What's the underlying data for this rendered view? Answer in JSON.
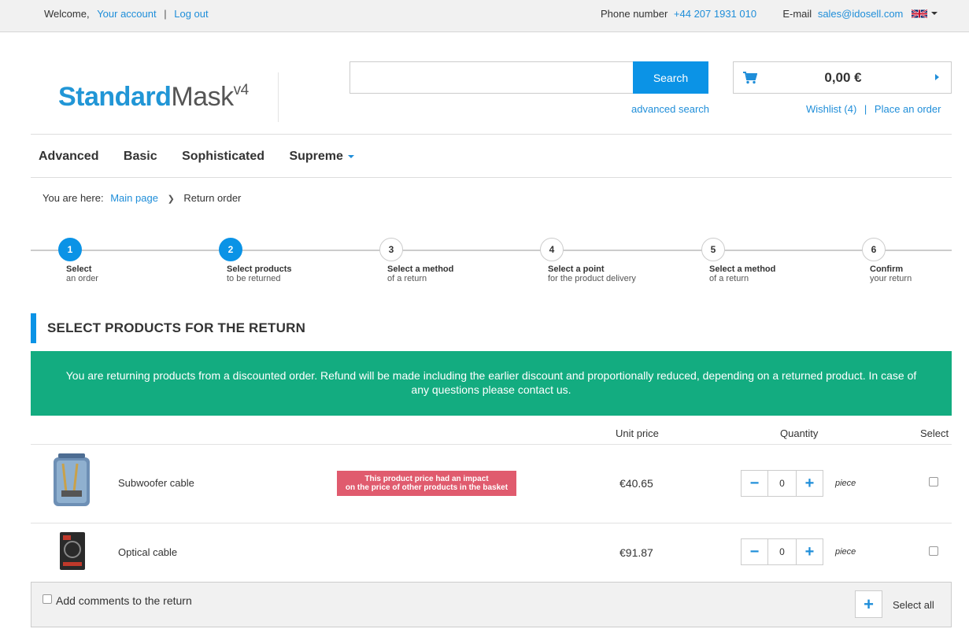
{
  "topbar": {
    "welcome": "Welcome,",
    "account_link": "Your account",
    "separator": "|",
    "logout_link": "Log out",
    "phone_label": "Phone number",
    "phone_value": "+44 207 1931 010",
    "email_label": "E-mail",
    "email_value": "sales@idosell.com",
    "language_icon": "uk-flag-icon"
  },
  "header": {
    "logo_part1": "Standard",
    "logo_part2": "Mask",
    "logo_sup": "v4",
    "search_value": "",
    "search_button": "Search",
    "advanced_search": "advanced search",
    "basket_total": "0,00 €",
    "wishlist_link": "Wishlist (4)",
    "place_order_link": "Place an order",
    "link_separator": "|"
  },
  "nav": {
    "items": [
      {
        "label": "Advanced"
      },
      {
        "label": "Basic"
      },
      {
        "label": "Sophisticated"
      },
      {
        "label": "Supreme"
      }
    ]
  },
  "breadcrumb": {
    "prefix": "You are here:",
    "home": "Main page",
    "current": "Return order"
  },
  "steps": [
    {
      "num": "1",
      "title": "Select",
      "sub": "an order",
      "active": true
    },
    {
      "num": "2",
      "title": "Select products",
      "sub": "to be returned",
      "active": true
    },
    {
      "num": "3",
      "title": "Select a method",
      "sub": "of a return",
      "active": false
    },
    {
      "num": "4",
      "title": "Select a point",
      "sub": "for the product delivery",
      "active": false
    },
    {
      "num": "5",
      "title": "Select a method",
      "sub": "of a return",
      "active": false
    },
    {
      "num": "6",
      "title": "Confirm",
      "sub": "your return",
      "active": false
    }
  ],
  "section_title": "SELECT PRODUCTS FOR THE RETURN",
  "notice": "You are returning products from a discounted order. Refund will be made including the earlier discount and proportionally reduced, depending on a returned product. In case of any questions please contact us.",
  "table": {
    "headers": {
      "unit_price": "Unit price",
      "quantity": "Quantity",
      "select": "Select"
    },
    "rows": [
      {
        "name": "Subwoofer cable",
        "price": "€40.65",
        "qty": "0",
        "unit": "piece",
        "warning_line1": "This product price had an impact",
        "warning_line2": "on the price of other products in the basket",
        "checked": false
      },
      {
        "name": "Optical cable",
        "price": "€91.87",
        "qty": "0",
        "unit": "piece",
        "checked": false
      }
    ],
    "minus": "−",
    "plus": "+"
  },
  "footer": {
    "comments_label": "Add comments to the return",
    "select_all": "Select all",
    "plus": "+"
  },
  "colors": {
    "accent": "#0b93e6",
    "link": "#1f8ed9",
    "notice_bg": "#13ac80",
    "warning_bg": "#e05b6e"
  }
}
